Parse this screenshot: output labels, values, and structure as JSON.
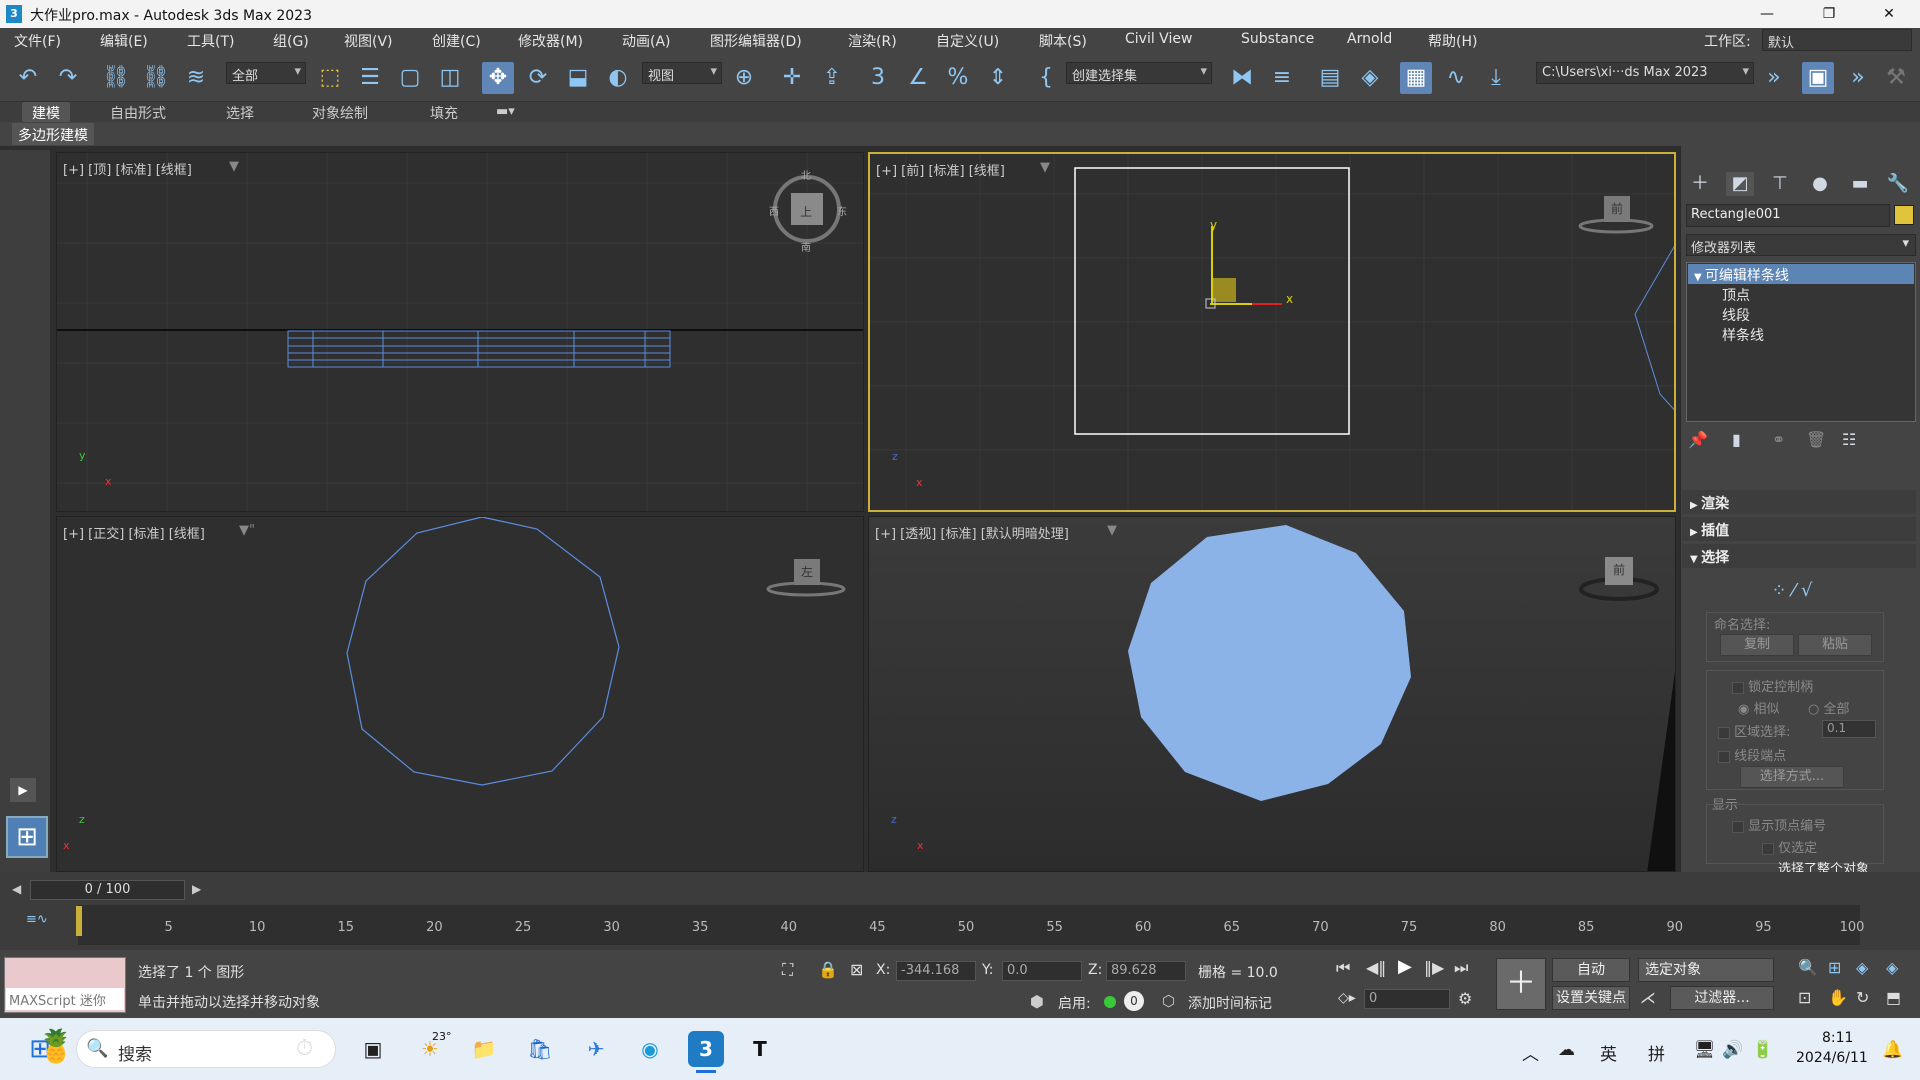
{
  "title": "大作业pro.max - Autodesk 3ds Max 2023",
  "app_icon": "3",
  "menu": [
    "文件(F)",
    "编辑(E)",
    "工具(T)",
    "组(G)",
    "视图(V)",
    "创建(C)",
    "修改器(M)",
    "动画(A)",
    "图形编辑器(D)",
    "渲染(R)",
    "自定义(U)",
    "脚本(S)",
    "Civil View",
    "Substance",
    "Arnold",
    "帮助(H)"
  ],
  "workspace": {
    "label": "工作区:",
    "value": "默认"
  },
  "toolbar": {
    "filter_value": "全部",
    "refcoord_value": "视图",
    "selset_value": "创建选择集",
    "path_value": "C:\\Users\\xi···ds Max 2023"
  },
  "ribbon": {
    "tabs": [
      "建模",
      "自由形式",
      "选择",
      "对象绘制",
      "填充"
    ],
    "subtab": "多边形建模"
  },
  "viewports": {
    "top": {
      "label": "[+] [顶] [标准] [线框]"
    },
    "front": {
      "label": "[+] [前] [标准] [线框]"
    },
    "ortho": {
      "label": "[+] [正交] [标准] [线框]"
    },
    "persp": {
      "label": "[+] [透视] [标准] [默认明暗处理]"
    }
  },
  "viewcube": {
    "top": "上",
    "front": "前",
    "left": "左",
    "north": "北",
    "south": "南",
    "east": "东",
    "west": "西"
  },
  "axis": {
    "x": "x",
    "y": "y",
    "z": "z"
  },
  "panel": {
    "object_name": "Rectangle001",
    "object_color": "#e2c43c",
    "modifier_list": "修改器列表",
    "stack": [
      "可编辑样条线",
      "顶点",
      "线段",
      "样条线"
    ],
    "rollouts": {
      "render": "渲染",
      "interp": "插值",
      "select": "选择"
    },
    "named_sel": "命名选择:",
    "copy": "复制",
    "paste": "粘贴",
    "lock_handles": "锁定控制柄",
    "similar": "相似",
    "all": "全部",
    "area_sel": "区域选择:",
    "area_val": "0.1",
    "seg_end": "线段端点",
    "sel_by": "选择方式...",
    "display": "显示",
    "show_vert": "显示顶点编号",
    "only_sel": "仅选定",
    "sel_info": "选择了整个对象"
  },
  "timeline": {
    "frame": "0 / 100",
    "ticks": [
      "5",
      "10",
      "15",
      "20",
      "25",
      "30",
      "35",
      "40",
      "45",
      "50",
      "55",
      "60",
      "65",
      "70",
      "75",
      "80",
      "85",
      "90",
      "95",
      "100"
    ]
  },
  "status": {
    "maxscript": "MAXScript 迷你",
    "selected": "选择了 1 个 图形",
    "prompt": "单击并拖动以选择并移动对象",
    "x_label": "X:",
    "x": "-344.168",
    "y_label": "Y:",
    "y": "0.0",
    "z_label": "Z:",
    "z": "89.628",
    "grid": "栅格 = 10.0",
    "enable": "启用:",
    "add_time_tag": "添加时间标记",
    "auto": "自动",
    "selected_obj": "选定对象",
    "set_key": "设置关键点",
    "filters": "过滤器...",
    "frame_input": "0",
    "zero_badge": "0"
  },
  "taskbar": {
    "search": "搜索",
    "weather": "23°",
    "ime1": "英",
    "ime2": "拼",
    "time": "8:11",
    "date": "2024/6/11"
  }
}
